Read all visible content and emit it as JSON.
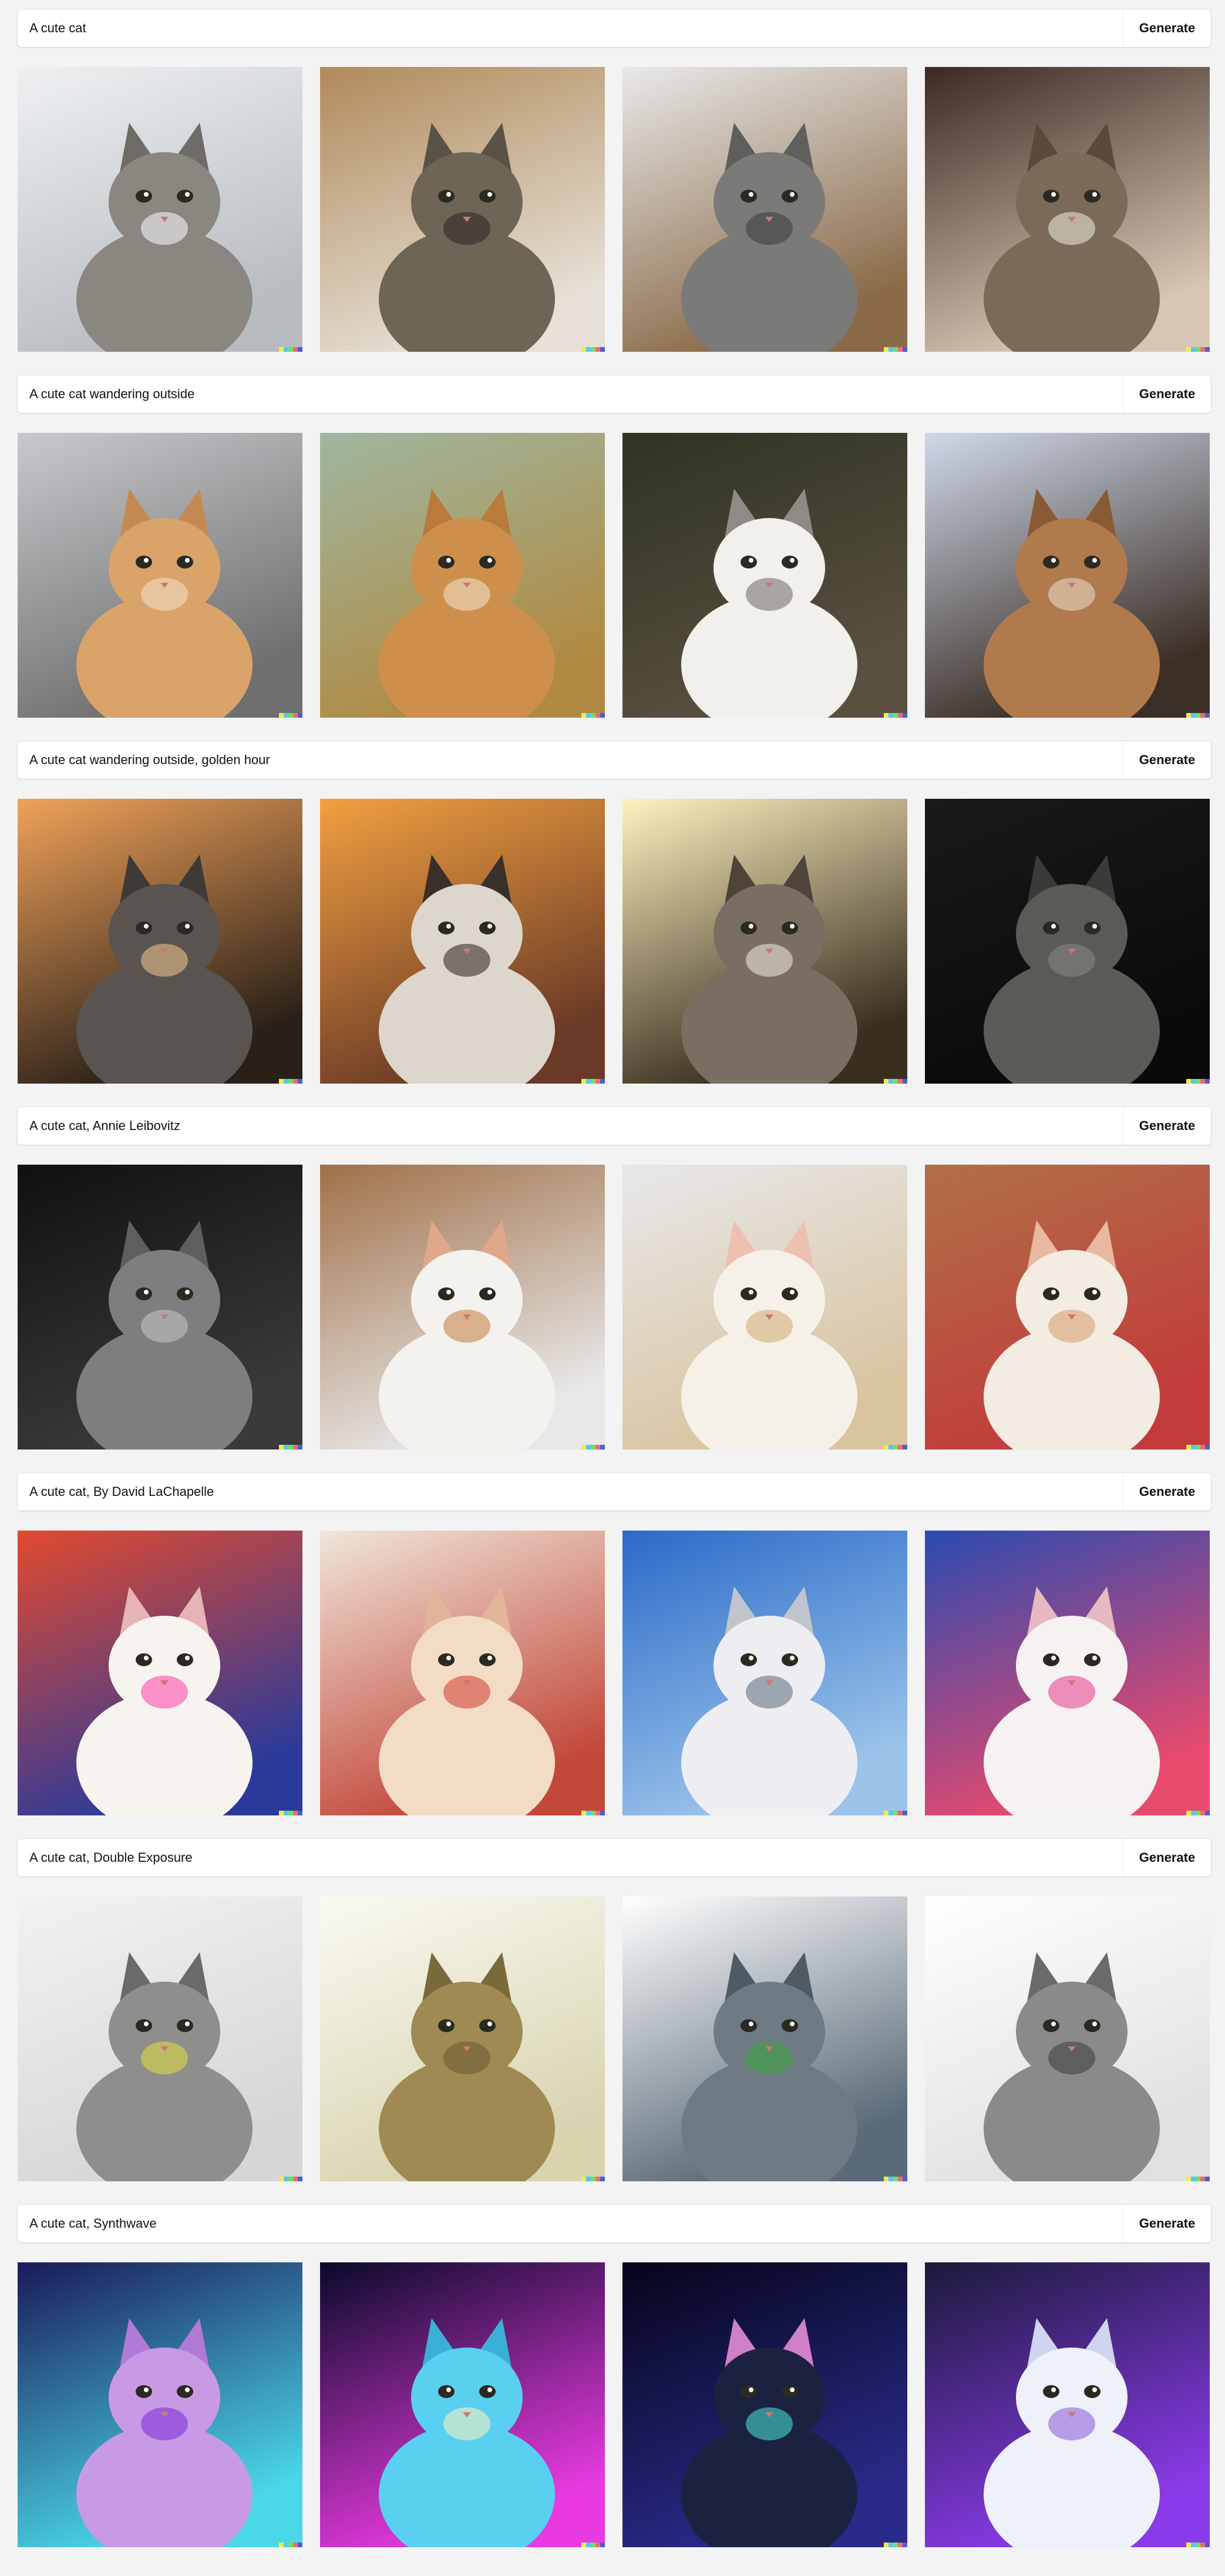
{
  "generate_label": "Generate",
  "sections": [
    {
      "prompt": "A cute cat",
      "tiles": [
        {
          "bg": [
            "#eef0f2",
            "#b8bcc0"
          ],
          "cat": "#8a8680",
          "accent": "#ffffff",
          "ear": "#6f6b66"
        },
        {
          "bg": [
            "#b08a5a",
            "#e6e0d6"
          ],
          "cat": "#6e6557",
          "accent": "#2b2722",
          "ear": "#5a5247"
        },
        {
          "bg": [
            "#e9e9e9",
            "#8a6a48"
          ],
          "cat": "#7a7a78",
          "accent": "#3a3a38",
          "ear": "#5f5f5d"
        },
        {
          "bg": [
            "#3a2a22",
            "#d8c6b4"
          ],
          "cat": "#7b6a58",
          "accent": "#f2ece4",
          "ear": "#5a4a3a"
        }
      ]
    },
    {
      "prompt": "A cute cat wandering outside",
      "tiles": [
        {
          "bg": [
            "#c7c9cc",
            "#6f6f70"
          ],
          "cat": "#d9a36a",
          "accent": "#f3e2c8",
          "ear": "#c48a52"
        },
        {
          "bg": [
            "#9fb7a0",
            "#b08a42"
          ],
          "cat": "#cf8f4c",
          "accent": "#f2e6d0",
          "ear": "#b97a3c"
        },
        {
          "bg": [
            "#2e3323",
            "#5a5040"
          ],
          "cat": "#f1f0ec",
          "accent": "#6e6a64",
          "ear": "#8f8b84"
        },
        {
          "bg": [
            "#cfd9ea",
            "#3b2e25"
          ],
          "cat": "#b07a4c",
          "accent": "#eadfcf",
          "ear": "#8a5a36"
        }
      ]
    },
    {
      "prompt": "A cute cat wandering outside, golden hour",
      "tiles": [
        {
          "bg": [
            "#f0a25a",
            "#2a2018"
          ],
          "cat": "#5a5450",
          "accent": "#f6c892",
          "ear": "#3e3a36"
        },
        {
          "bg": [
            "#f2a040",
            "#6a3a26"
          ],
          "cat": "#ddd6cc",
          "accent": "#2a221c",
          "ear": "#3a302a"
        },
        {
          "bg": [
            "#fff2c0",
            "#3a2e20"
          ],
          "cat": "#7a6e62",
          "accent": "#f3ede4",
          "ear": "#4e443a"
        },
        {
          "bg": [
            "#181a1a",
            "#0a0a0a"
          ],
          "cat": "#5a5a56",
          "accent": "#8a8a84",
          "ear": "#3a3a38"
        }
      ]
    },
    {
      "prompt": "A cute cat, Annie Leibovitz",
      "tiles": [
        {
          "bg": [
            "#101010",
            "#3a3a3a"
          ],
          "cat": "#7e7e80",
          "accent": "#c8c8c8",
          "ear": "#5e5e60"
        },
        {
          "bg": [
            "#a07048",
            "#e8e8e8"
          ],
          "cat": "#f4f2ee",
          "accent": "#c27a3c",
          "ear": "#e0a888"
        },
        {
          "bg": [
            "#e8e8ea",
            "#d9c4a0"
          ],
          "cat": "#f6f1e8",
          "accent": "#d0a870",
          "ear": "#eec0b0"
        },
        {
          "bg": [
            "#b07048",
            "#c23b3b"
          ],
          "cat": "#f3ece2",
          "accent": "#d69a68",
          "ear": "#e8b8a0"
        }
      ]
    },
    {
      "prompt": "A cute cat, By David LaChapelle",
      "tiles": [
        {
          "bg": [
            "#e24a2e",
            "#2b3a9a"
          ],
          "cat": "#f7f4f0",
          "accent": "#ff3ca8",
          "ear": "#e6b4b4"
        },
        {
          "bg": [
            "#f0e6da",
            "#c2483a"
          ],
          "cat": "#f3dcc6",
          "accent": "#d23a30",
          "ear": "#e2b49a"
        },
        {
          "bg": [
            "#2a6ac8",
            "#9cc4ea"
          ],
          "cat": "#eeeef2",
          "accent": "#5a6a7a",
          "ear": "#c0c4cc"
        },
        {
          "bg": [
            "#2a4ab0",
            "#e84a6e"
          ],
          "cat": "#f6f2f2",
          "accent": "#e83a8a",
          "ear": "#e6b8c2"
        }
      ]
    },
    {
      "prompt": "A cute cat, Double Exposure",
      "tiles": [
        {
          "bg": [
            "#f2f2f4",
            "#d6d6d8"
          ],
          "cat": "#8e8e8c",
          "accent": "#e2e040",
          "ear": "#6a6a68"
        },
        {
          "bg": [
            "#fafaf2",
            "#d8d4b0"
          ],
          "cat": "#9e8a52",
          "accent": "#6a5a30",
          "ear": "#7a6a3a"
        },
        {
          "bg": [
            "#ffffff",
            "#5a6a78"
          ],
          "cat": "#6e7a84",
          "accent": "#3aaa3a",
          "ear": "#4e5a64"
        },
        {
          "bg": [
            "#ffffff",
            "#e0e0e0"
          ],
          "cat": "#8a8a8a",
          "accent": "#3a3a3a",
          "ear": "#6a6a6a"
        }
      ]
    },
    {
      "prompt": "A cute cat, Synthwave",
      "tiles": [
        {
          "bg": [
            "#1a1a5a",
            "#4ad8e8"
          ],
          "cat": "#c89ae6",
          "accent": "#7a2ad8",
          "ear": "#b07ad6"
        },
        {
          "bg": [
            "#0a0a2a",
            "#e83ae0"
          ],
          "cat": "#5ad0f0",
          "accent": "#fff2c0",
          "ear": "#3ab0d8"
        },
        {
          "bg": [
            "#05051a",
            "#2a2a8a"
          ],
          "cat": "#1a2240",
          "accent": "#4ae8d8",
          "ear": "#d080c8"
        },
        {
          "bg": [
            "#1a1a3a",
            "#8a3ae8"
          ],
          "cat": "#eef0fa",
          "accent": "#8a5ad8",
          "ear": "#d0d4f0"
        }
      ]
    }
  ]
}
